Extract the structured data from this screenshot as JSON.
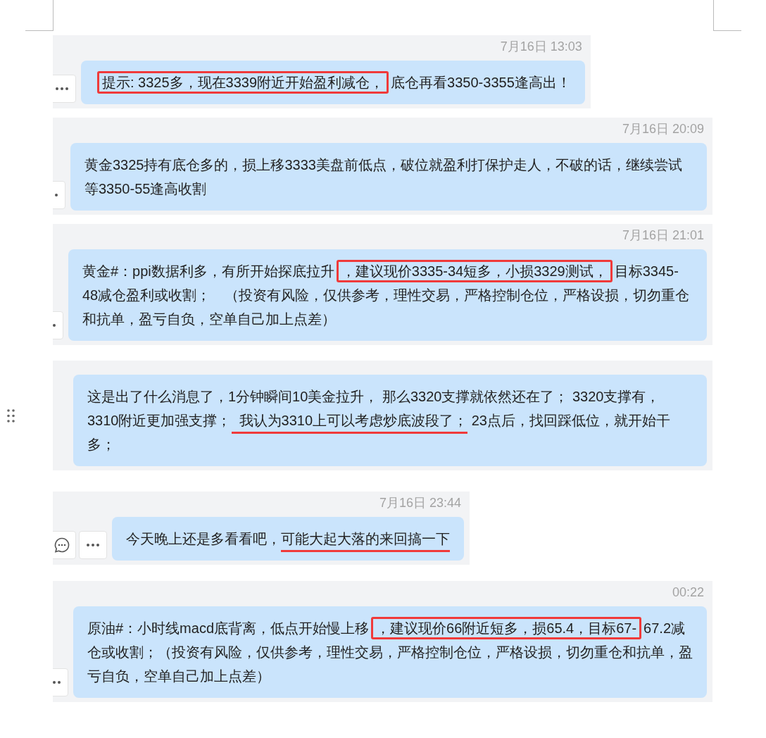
{
  "messages": [
    {
      "timestamp": "7月16日 13:03",
      "actions": [
        {
          "kind": "more"
        }
      ],
      "drag_handle": false,
      "segments": [
        {
          "text": "提示: 3325多，现在3339附近开始盈利减仓，",
          "boxed": true,
          "underlined": false
        },
        {
          "text": "底仓再看3350-3355逢高出！",
          "boxed": false,
          "underlined": false
        }
      ]
    },
    {
      "timestamp": "7月16日 20:09",
      "actions": [
        {
          "kind": "more"
        }
      ],
      "drag_handle": false,
      "segments": [
        {
          "text": "黄金3325持有底仓多的，损上移3333美盘前低点，破位就盈利打保护走人，不破的话，继续尝试等3350-55逢高收割",
          "boxed": false,
          "underlined": false
        }
      ]
    },
    {
      "timestamp": "7月16日 21:01",
      "actions": [
        {
          "kind": "more"
        }
      ],
      "drag_handle": false,
      "segments": [
        {
          "text": "黄金#：ppi数据利多，有所开始探底拉升",
          "boxed": false,
          "underlined": false
        },
        {
          "text": "，建议现价3335-34短多，小损3329测试，",
          "boxed": true,
          "underlined": false
        },
        {
          "text": "目标3345-48减仓盈利或收割；　（投资有风险，仅供参考，理性交易，严格控制仓位，严格设损，切勿重仓和抗单，盈亏自负，空单自己加上点差）",
          "boxed": false,
          "underlined": false
        }
      ]
    },
    {
      "drag_handle": true,
      "segments": [
        {
          "text": "这是出了什么消息了，1分钟瞬间10美金拉升， 那么3320支撑就依然还在了； 3320支撑有， 3310附近更加强支撑；",
          "boxed": false,
          "underlined": false
        },
        {
          "text": "  我认为3310上可以考虑炒底波段了；",
          "boxed": false,
          "underlined": true
        },
        {
          "text": " 23点后，找回踩低位，就开始干多；",
          "boxed": false,
          "underlined": false
        }
      ]
    },
    {
      "timestamp": "7月16日 23:44",
      "actions": [
        {
          "kind": "comment"
        },
        {
          "kind": "more"
        }
      ],
      "drag_handle": false,
      "segments": [
        {
          "text": "今天晚上还是多看看吧，",
          "boxed": false,
          "underlined": false
        },
        {
          "text": "可能大起大落的来回搞一下",
          "boxed": false,
          "underlined": true
        }
      ]
    },
    {
      "timestamp": "00:22",
      "actions": [
        {
          "kind": "more"
        }
      ],
      "drag_handle": false,
      "segments": [
        {
          "text": "原油#：小时线macd底背离，低点开始慢上移",
          "boxed": false,
          "underlined": false
        },
        {
          "text": "，建议现价66附近短多，损65.4，目标67-",
          "boxed": true,
          "underlined": false
        },
        {
          "text": "67.2减仓或收割；（投资有风险，仅供参考，理性交易，严格控制仓位，严格设损，切勿重仓和抗单，盈亏自负，空单自己加上点差）",
          "boxed": false,
          "underlined": false
        }
      ]
    }
  ]
}
